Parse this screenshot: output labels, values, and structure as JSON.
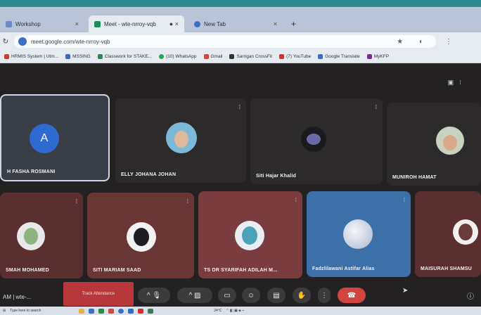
{
  "browser": {
    "tabs": [
      {
        "label": "Workshop",
        "active": false
      },
      {
        "label": "Meet - wte-nrroy-vqb",
        "active": true
      },
      {
        "label": "New Tab",
        "active": false
      }
    ],
    "new_tab": "+",
    "url": "meet.google.com/wte-nrroy-vqb",
    "bookmarks": [
      {
        "label": "HRMIS System | Utm...",
        "color": "#cc3b2c"
      },
      {
        "label": "MSSING",
        "color": "#2f6ad1"
      },
      {
        "label": "Classwork for STAKE...",
        "color": "#2a8b4a"
      },
      {
        "label": "(10) WhatsApp",
        "color": "#2aa84e"
      },
      {
        "label": "Gmail",
        "color": "#d44638"
      },
      {
        "label": "Sarrigan CrossFit",
        "color": "#333333"
      },
      {
        "label": "(7) YouTube",
        "color": "#e02b2b"
      },
      {
        "label": "Google Translate",
        "color": "#3a6fc4"
      },
      {
        "label": "MyKFP",
        "color": "#7a2c8c"
      }
    ]
  },
  "participants": [
    {
      "name": "H FASHA ROSMANI",
      "initial": "A"
    },
    {
      "name": "ELLY JOHANA JOHAN"
    },
    {
      "name": "Siti Hajar Khalid"
    },
    {
      "name": "MUNIROH HAMAT"
    },
    {
      "name": "SMAH MOHAMED"
    },
    {
      "name": "SITI MARIAM SAAD"
    },
    {
      "name": "TS DR SYARIFAH ADILAH M..."
    },
    {
      "name": "Fadzlilawani Astifar Alias"
    },
    {
      "name": "MAISURAH SHAMSU"
    }
  ],
  "controls": {
    "meeting_code": "AM | wte-...",
    "attendance_label": "Track Attendance"
  },
  "taskbar": {
    "search": "Type here to search",
    "weather": "24°C"
  }
}
